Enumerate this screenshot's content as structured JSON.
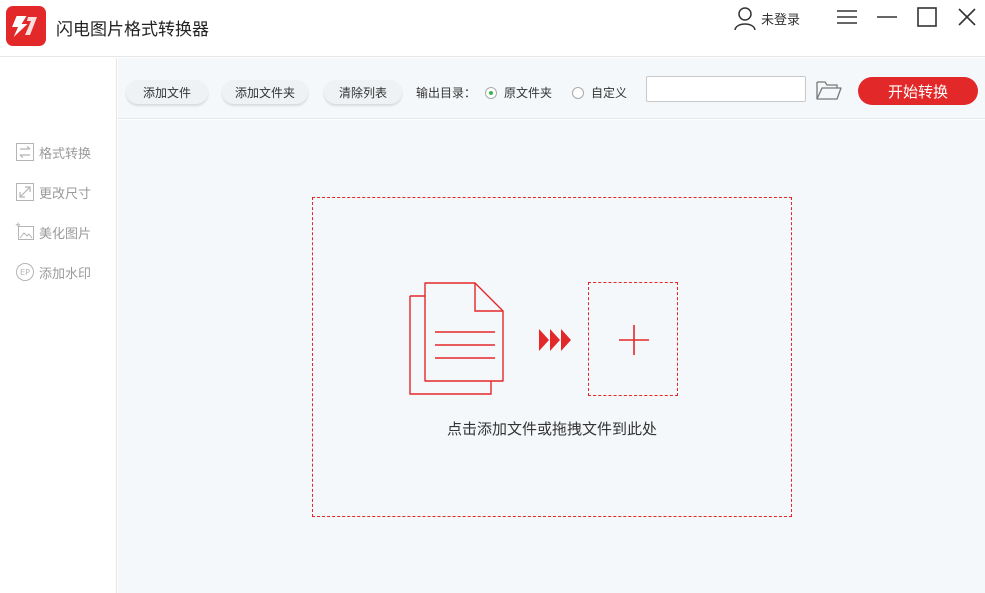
{
  "app": {
    "title": "闪电图片格式转换器",
    "user_label": "未登录"
  },
  "sidebar": {
    "items": [
      {
        "label": "格式转换",
        "icon": "swap-arrows-icon"
      },
      {
        "label": "更改尺寸",
        "icon": "resize-icon"
      },
      {
        "label": "美化图片",
        "icon": "image-beautify-icon"
      },
      {
        "label": "添加水印",
        "icon": "watermark-icon"
      }
    ]
  },
  "toolbar": {
    "add_file_label": "添加文件",
    "add_folder_label": "添加文件夹",
    "clear_list_label": "清除列表",
    "output_dir_label": "输出目录：",
    "radio_original_label": "原文件夹",
    "radio_custom_label": "自定义",
    "selected_output": "原文件夹",
    "path_value": "",
    "start_label": "开始转换"
  },
  "main": {
    "drop_hint": "点击添加文件或拖拽文件到此处"
  },
  "colors": {
    "accent": "#e3282a",
    "radio_checked": "#3cb84a",
    "sidebar_text": "#9a9a9a",
    "background": "#f5f8fb"
  }
}
